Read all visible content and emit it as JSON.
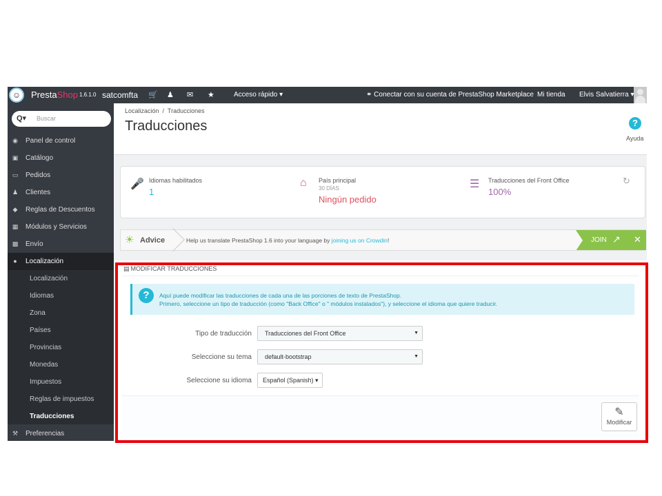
{
  "topbar": {
    "logo_main": "Presta",
    "logo_accent": "Shop",
    "version": "1.6.1.0",
    "store_name": "satcomfta",
    "quick_access": "Acceso rápido",
    "marketplace": "Conectar con su cuenta de PrestaShop Marketplace",
    "my_store": "Mi tienda",
    "user_name": "Elvis Salvatierra"
  },
  "sidebar": {
    "search_placeholder": "Buscar",
    "items": [
      {
        "label": "Panel de control",
        "icon": "dashboard-icon"
      },
      {
        "label": "Catálogo",
        "icon": "book-icon"
      },
      {
        "label": "Pedidos",
        "icon": "credit-card-icon"
      },
      {
        "label": "Clientes",
        "icon": "users-icon"
      },
      {
        "label": "Reglas de Descuentos",
        "icon": "tag-icon"
      },
      {
        "label": "Módulos y Servicios",
        "icon": "puzzle-icon"
      },
      {
        "label": "Envío",
        "icon": "truck-icon"
      },
      {
        "label": "Localización",
        "icon": "globe-icon"
      }
    ],
    "subitems": [
      {
        "label": "Localización"
      },
      {
        "label": "Idiomas"
      },
      {
        "label": "Zona"
      },
      {
        "label": "Países"
      },
      {
        "label": "Provincias"
      },
      {
        "label": "Monedas"
      },
      {
        "label": "Impuestos"
      },
      {
        "label": "Reglas de impuestos"
      },
      {
        "label": "Traducciones"
      }
    ],
    "preferences": "Preferencias"
  },
  "header": {
    "breadcrumb_parent": "Localización",
    "breadcrumb_sep": "/",
    "breadcrumb_current": "Traducciones",
    "title": "Traducciones",
    "help_label": "Ayuda"
  },
  "kpis": [
    {
      "label": "Idiomas habilitados",
      "sub": "",
      "value": "1",
      "value_color": "#25b9d7",
      "icon": "microphone-icon"
    },
    {
      "label": "País principal",
      "sub": "30 DÍAS",
      "value": "Ningún pedido",
      "value_color": "#e04f5f",
      "icon": "home-icon"
    },
    {
      "label": "Traducciones del Front Office",
      "sub": "",
      "value": "100%",
      "value_color": "#a066aa",
      "icon": "list-icon"
    }
  ],
  "advice": {
    "label": "Advice",
    "text_before": "Help us translate PrestaShop 1.6 into your language by ",
    "link_text": "joining us on Crowdin",
    "text_after": "!",
    "join_label": "JOIN"
  },
  "panel": {
    "heading": "MODIFICAR TRADUCCIONES",
    "info_line1": "Aquí puede modificar las traducciones de cada una de las porciones de texto de PrestaShop.",
    "info_line2": "Primero, seleccione un tipo de traducción (como \"Back Office\" o \" módulos instalados\"), y seleccione el idioma que quiere traducir.",
    "type_label": "Tipo de traducción",
    "type_value": "Traducciones del Front Office",
    "theme_label": "Seleccione su tema",
    "theme_value": "default-bootstrap",
    "language_label": "Seleccione su idioma",
    "language_value": "Español (Spanish)",
    "modify_label": "Modificar"
  },
  "colors": {
    "accent": "#25b9d7",
    "highlight": "#e8000b",
    "join": "#8bc34a"
  }
}
